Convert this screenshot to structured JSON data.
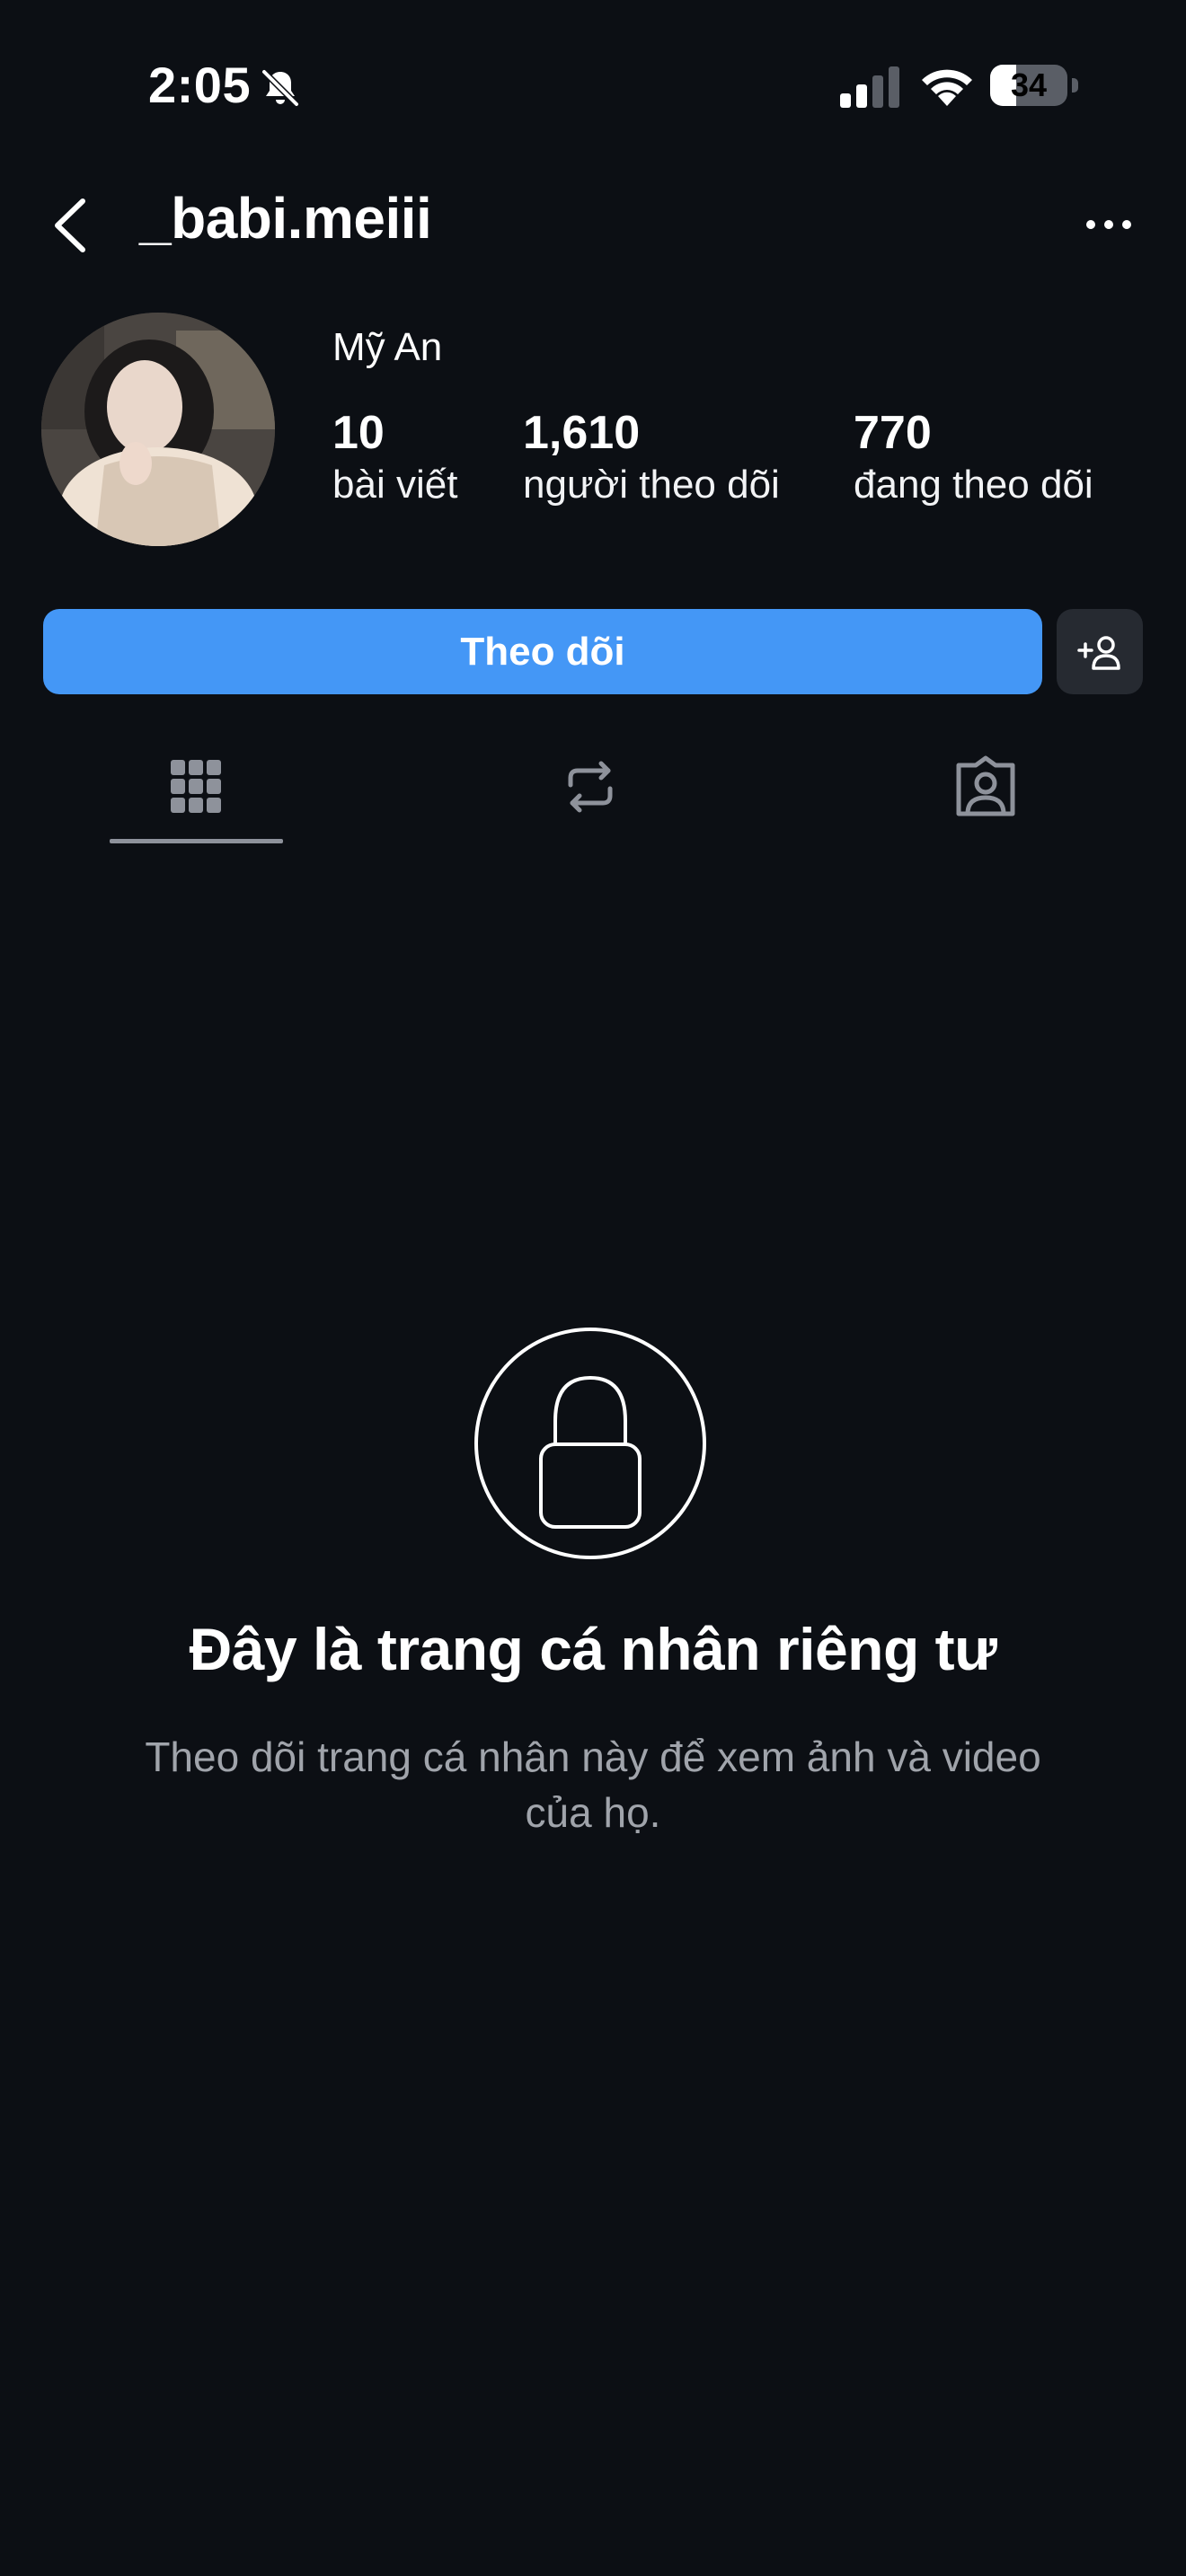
{
  "status_bar": {
    "time": "2:05",
    "battery_level": "34",
    "battery_fraction": 0.34,
    "icons": [
      "bell-slash-icon",
      "cellular-signal-icon",
      "wifi-icon",
      "battery-icon"
    ]
  },
  "header": {
    "username": "_babi.meiii",
    "back_icon": "chevron-left-icon",
    "more_icon": "more-horizontal-icon"
  },
  "profile": {
    "display_name": "Mỹ An",
    "stats": [
      {
        "value": "10",
        "label": "bài viết"
      },
      {
        "value": "1,610",
        "label": "người theo dõi"
      },
      {
        "value": "770",
        "label": "đang theo dõi"
      }
    ]
  },
  "actions": {
    "follow_label": "Theo dõi",
    "suggest_icon": "add-person-icon"
  },
  "tabs": [
    {
      "icon": "grid-icon",
      "selected": true
    },
    {
      "icon": "repost-icon",
      "selected": false
    },
    {
      "icon": "tagged-icon",
      "selected": false
    }
  ],
  "private": {
    "icon": "lock-icon",
    "title": "Đây là trang cá nhân riêng tư",
    "description": "Theo dõi trang cá nhân này để xem ảnh và video của họ."
  },
  "colors": {
    "background": "#0c0f14",
    "accent": "#4497f6",
    "secondary_button": "#262a31",
    "muted_text": "#a0a4ab"
  }
}
